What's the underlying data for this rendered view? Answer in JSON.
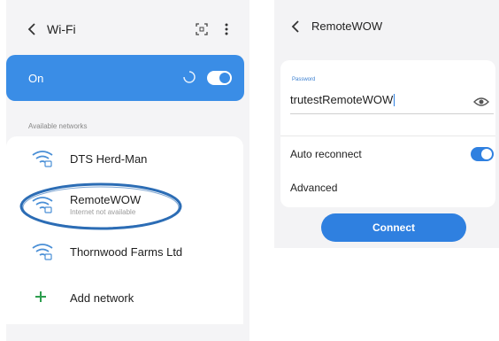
{
  "left": {
    "title": "Wi-Fi",
    "on_label": "On",
    "section_label": "Available networks",
    "networks": [
      {
        "name": "DTS Herd-Man",
        "sub": ""
      },
      {
        "name": "RemoteWOW",
        "sub": "Internet not available"
      },
      {
        "name": "Thornwood Farms Ltd",
        "sub": ""
      }
    ],
    "add_network_label": "Add network",
    "icons": [
      "back-arrow-icon",
      "qr-scan-icon",
      "more-vert-icon",
      "wifi-lock-icon",
      "plus-icon"
    ]
  },
  "right": {
    "title": "RemoteWOW",
    "password_label": "Password",
    "password_value": "trutestRemoteWOW",
    "auto_reconnect_label": "Auto reconnect",
    "advanced_label": "Advanced",
    "connect_label": "Connect",
    "icons": [
      "back-arrow-icon",
      "eye-icon"
    ]
  },
  "colors": {
    "accent": "#3a8de6",
    "annotation_ring": "#2c6db5"
  }
}
